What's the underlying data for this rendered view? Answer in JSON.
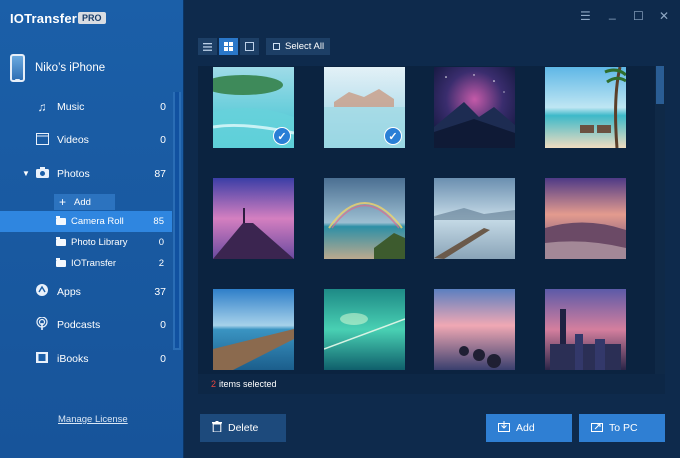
{
  "app": {
    "title": "IOTransfer",
    "badge": "PRO"
  },
  "device": {
    "name": "Niko’s iPhone",
    "icon": "iphone-icon"
  },
  "nav": {
    "items": [
      {
        "label": "Music",
        "count": "0",
        "icon": "music-note-icon"
      },
      {
        "label": "Videos",
        "count": "0",
        "icon": "film-icon"
      },
      {
        "label": "Photos",
        "count": "87",
        "icon": "camera-icon",
        "expanded": true
      },
      {
        "label": "Apps",
        "count": "37",
        "icon": "app-store-icon"
      },
      {
        "label": "Podcasts",
        "count": "0",
        "icon": "podcast-icon"
      },
      {
        "label": "iBooks",
        "count": "0",
        "icon": "book-icon"
      }
    ],
    "add_label": "Add",
    "sub_items": [
      {
        "label": "Camera Roll",
        "count": "85",
        "active": true
      },
      {
        "label": "Photo Library",
        "count": "0"
      },
      {
        "label": "IOTransfer",
        "count": "2"
      }
    ]
  },
  "footer": {
    "manage_license": "Manage License"
  },
  "toolbar": {
    "select_all": "Select All",
    "active_view": "grid"
  },
  "photos": [
    {
      "name": "tropical-lagoon",
      "selected": true
    },
    {
      "name": "coastal-village",
      "selected": true
    },
    {
      "name": "starry-mountain",
      "selected": false
    },
    {
      "name": "beach-chairs-palm",
      "selected": false
    },
    {
      "name": "pier-sunset-purple",
      "selected": false
    },
    {
      "name": "rainbow-beach",
      "selected": false
    },
    {
      "name": "misty-jetty",
      "selected": false
    },
    {
      "name": "sunset-hills",
      "selected": false
    },
    {
      "name": "wooden-pier-sea",
      "selected": false
    },
    {
      "name": "green-bridge-sea",
      "selected": false
    },
    {
      "name": "rocky-shore-dusk",
      "selected": false
    },
    {
      "name": "city-skyline-night",
      "selected": false
    }
  ],
  "status": {
    "count": "2",
    "text": "items selected"
  },
  "buttons": {
    "delete": "Delete",
    "add": "Add",
    "to_pc": "To PC"
  },
  "colors": {
    "sidebar": "#1b5fa8",
    "active_item": "#2f86e0",
    "background": "#0e2a4c",
    "primary_button": "#2f7fd3",
    "selected_count": "#e8453c"
  }
}
